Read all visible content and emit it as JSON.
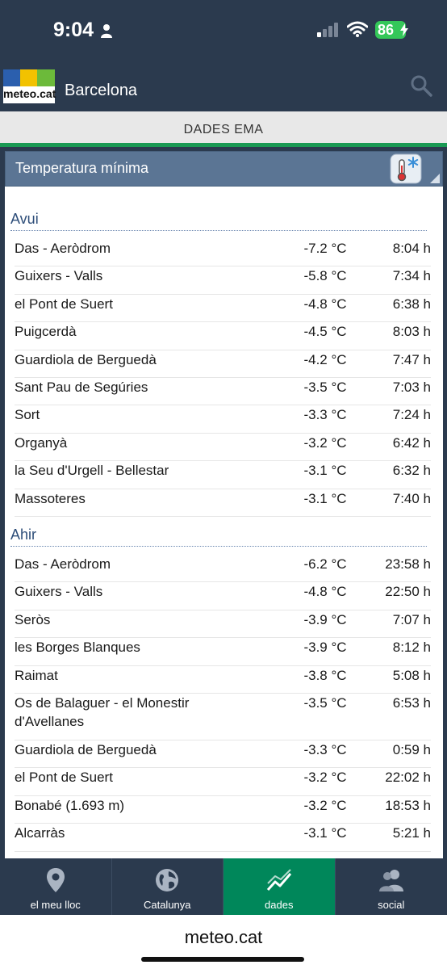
{
  "status": {
    "time": "9:04",
    "battery": "86"
  },
  "header": {
    "logo_text": "meteo.cat",
    "city": "Barcelona"
  },
  "tab": {
    "title": "DADES EMA"
  },
  "panel": {
    "title": "Temperatura mínima"
  },
  "sections": [
    {
      "title": "Avui",
      "rows": [
        {
          "station": "Das - Aeròdrom",
          "temp": "-7.2 °C",
          "time": "8:04 h"
        },
        {
          "station": "Guixers - Valls",
          "temp": "-5.8 °C",
          "time": "7:34 h"
        },
        {
          "station": "el Pont de Suert",
          "temp": "-4.8 °C",
          "time": "6:38 h"
        },
        {
          "station": "Puigcerdà",
          "temp": "-4.5 °C",
          "time": "8:03 h"
        },
        {
          "station": "Guardiola de Berguedà",
          "temp": "-4.2 °C",
          "time": "7:47 h"
        },
        {
          "station": "Sant Pau de Segúries",
          "temp": "-3.5 °C",
          "time": "7:03 h"
        },
        {
          "station": "Sort",
          "temp": "-3.3 °C",
          "time": "7:24 h"
        },
        {
          "station": "Organyà",
          "temp": "-3.2 °C",
          "time": "6:42 h"
        },
        {
          "station": "la Seu d'Urgell - Bellestar",
          "temp": "-3.1 °C",
          "time": "6:32 h"
        },
        {
          "station": "Massoteres",
          "temp": "-3.1 °C",
          "time": "7:40 h"
        }
      ]
    },
    {
      "title": "Ahir",
      "rows": [
        {
          "station": "Das - Aeròdrom",
          "temp": "-6.2 °C",
          "time": "23:58 h"
        },
        {
          "station": "Guixers - Valls",
          "temp": "-4.8 °C",
          "time": "22:50 h"
        },
        {
          "station": "Seròs",
          "temp": "-3.9 °C",
          "time": "7:07 h"
        },
        {
          "station": "les Borges Blanques",
          "temp": "-3.9 °C",
          "time": "8:12 h"
        },
        {
          "station": "Raimat",
          "temp": "-3.8 °C",
          "time": "5:08 h"
        },
        {
          "station": "Os de Balaguer - el Monestir d'Avellanes",
          "temp": "-3.5 °C",
          "time": "6:53 h"
        },
        {
          "station": "Guardiola de Berguedà",
          "temp": "-3.3 °C",
          "time": "0:59 h"
        },
        {
          "station": "el Pont de Suert",
          "temp": "-3.2 °C",
          "time": "22:02 h"
        },
        {
          "station": "Bonabé (1.693 m)",
          "temp": "-3.2 °C",
          "time": "18:53 h"
        },
        {
          "station": "Alcarràs",
          "temp": "-3.1 °C",
          "time": "5:21 h"
        }
      ]
    }
  ],
  "nav": [
    {
      "label": "el meu lloc",
      "icon": "location-pin-icon"
    },
    {
      "label": "Catalunya",
      "icon": "globe-icon"
    },
    {
      "label": "dades",
      "icon": "chart-line-icon",
      "active": true
    },
    {
      "label": "social",
      "icon": "users-icon"
    }
  ],
  "browser": {
    "url": "meteo.cat"
  },
  "colors": {
    "header_bg": "#2b3a4e",
    "accent_green": "#00875a",
    "panel_bg": "#5b7594",
    "section_text": "#2e4e79"
  }
}
